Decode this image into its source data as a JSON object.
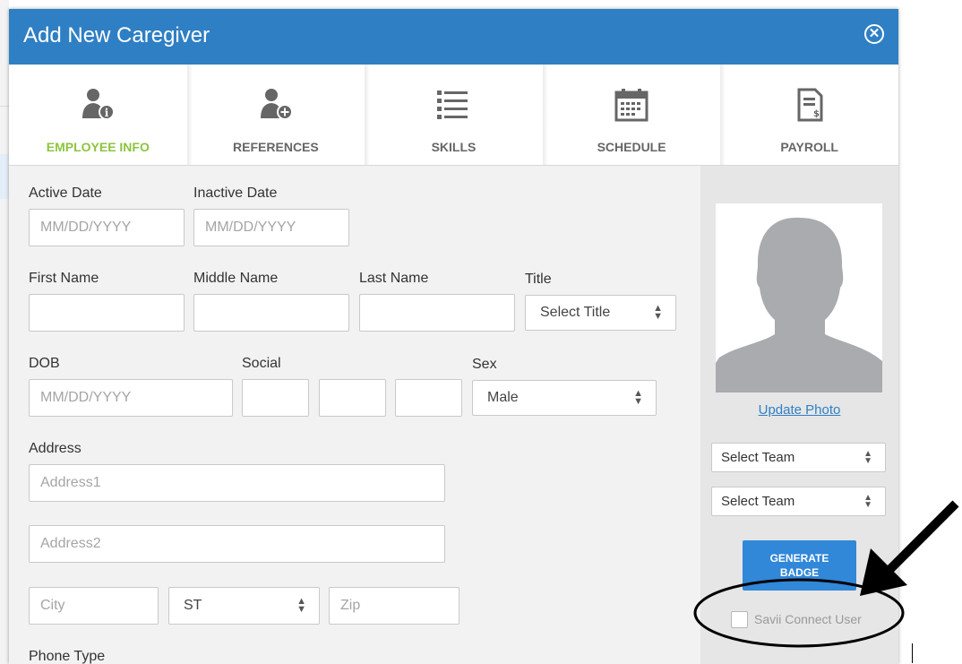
{
  "modal": {
    "title": "Add New Caregiver"
  },
  "tabs": [
    {
      "label": "EMPLOYEE INFO",
      "icon": "user-info-icon",
      "active": true
    },
    {
      "label": "REFERENCES",
      "icon": "user-add-icon",
      "active": false
    },
    {
      "label": "SKILLS",
      "icon": "list-icon",
      "active": false
    },
    {
      "label": "SCHEDULE",
      "icon": "calendar-icon",
      "active": false
    },
    {
      "label": "PAYROLL",
      "icon": "invoice-icon",
      "active": false
    }
  ],
  "form": {
    "active_date": {
      "label": "Active Date",
      "placeholder": "MM/DD/YYYY",
      "value": ""
    },
    "inactive_date": {
      "label": "Inactive Date",
      "placeholder": "MM/DD/YYYY",
      "value": ""
    },
    "first_name": {
      "label": "First Name",
      "value": ""
    },
    "middle_name": {
      "label": "Middle Name",
      "value": ""
    },
    "last_name": {
      "label": "Last Name",
      "value": ""
    },
    "title": {
      "label": "Title",
      "selected": "Select Title"
    },
    "dob": {
      "label": "DOB",
      "placeholder": "MM/DD/YYYY",
      "value": ""
    },
    "social": {
      "label": "Social",
      "parts": [
        "",
        "",
        ""
      ]
    },
    "sex": {
      "label": "Sex",
      "selected": "Male"
    },
    "address": {
      "label": "Address",
      "address1_placeholder": "Address1",
      "address2_placeholder": "Address2",
      "city_placeholder": "City",
      "state_selected": "ST",
      "zip_placeholder": "Zip"
    },
    "phone_type": {
      "label": "Phone Type"
    }
  },
  "side": {
    "update_photo": "Update Photo",
    "team_selects": [
      "Select Team",
      "Select Team"
    ],
    "generate_badge": [
      "GENERATE",
      "BADGE"
    ],
    "savii_connect": {
      "label": "Savii Connect User",
      "checked": false
    }
  },
  "colors": {
    "header": "#2f7fc4",
    "active_tab": "#8cc43f",
    "button": "#3187d8",
    "link": "#2f7fc4"
  }
}
